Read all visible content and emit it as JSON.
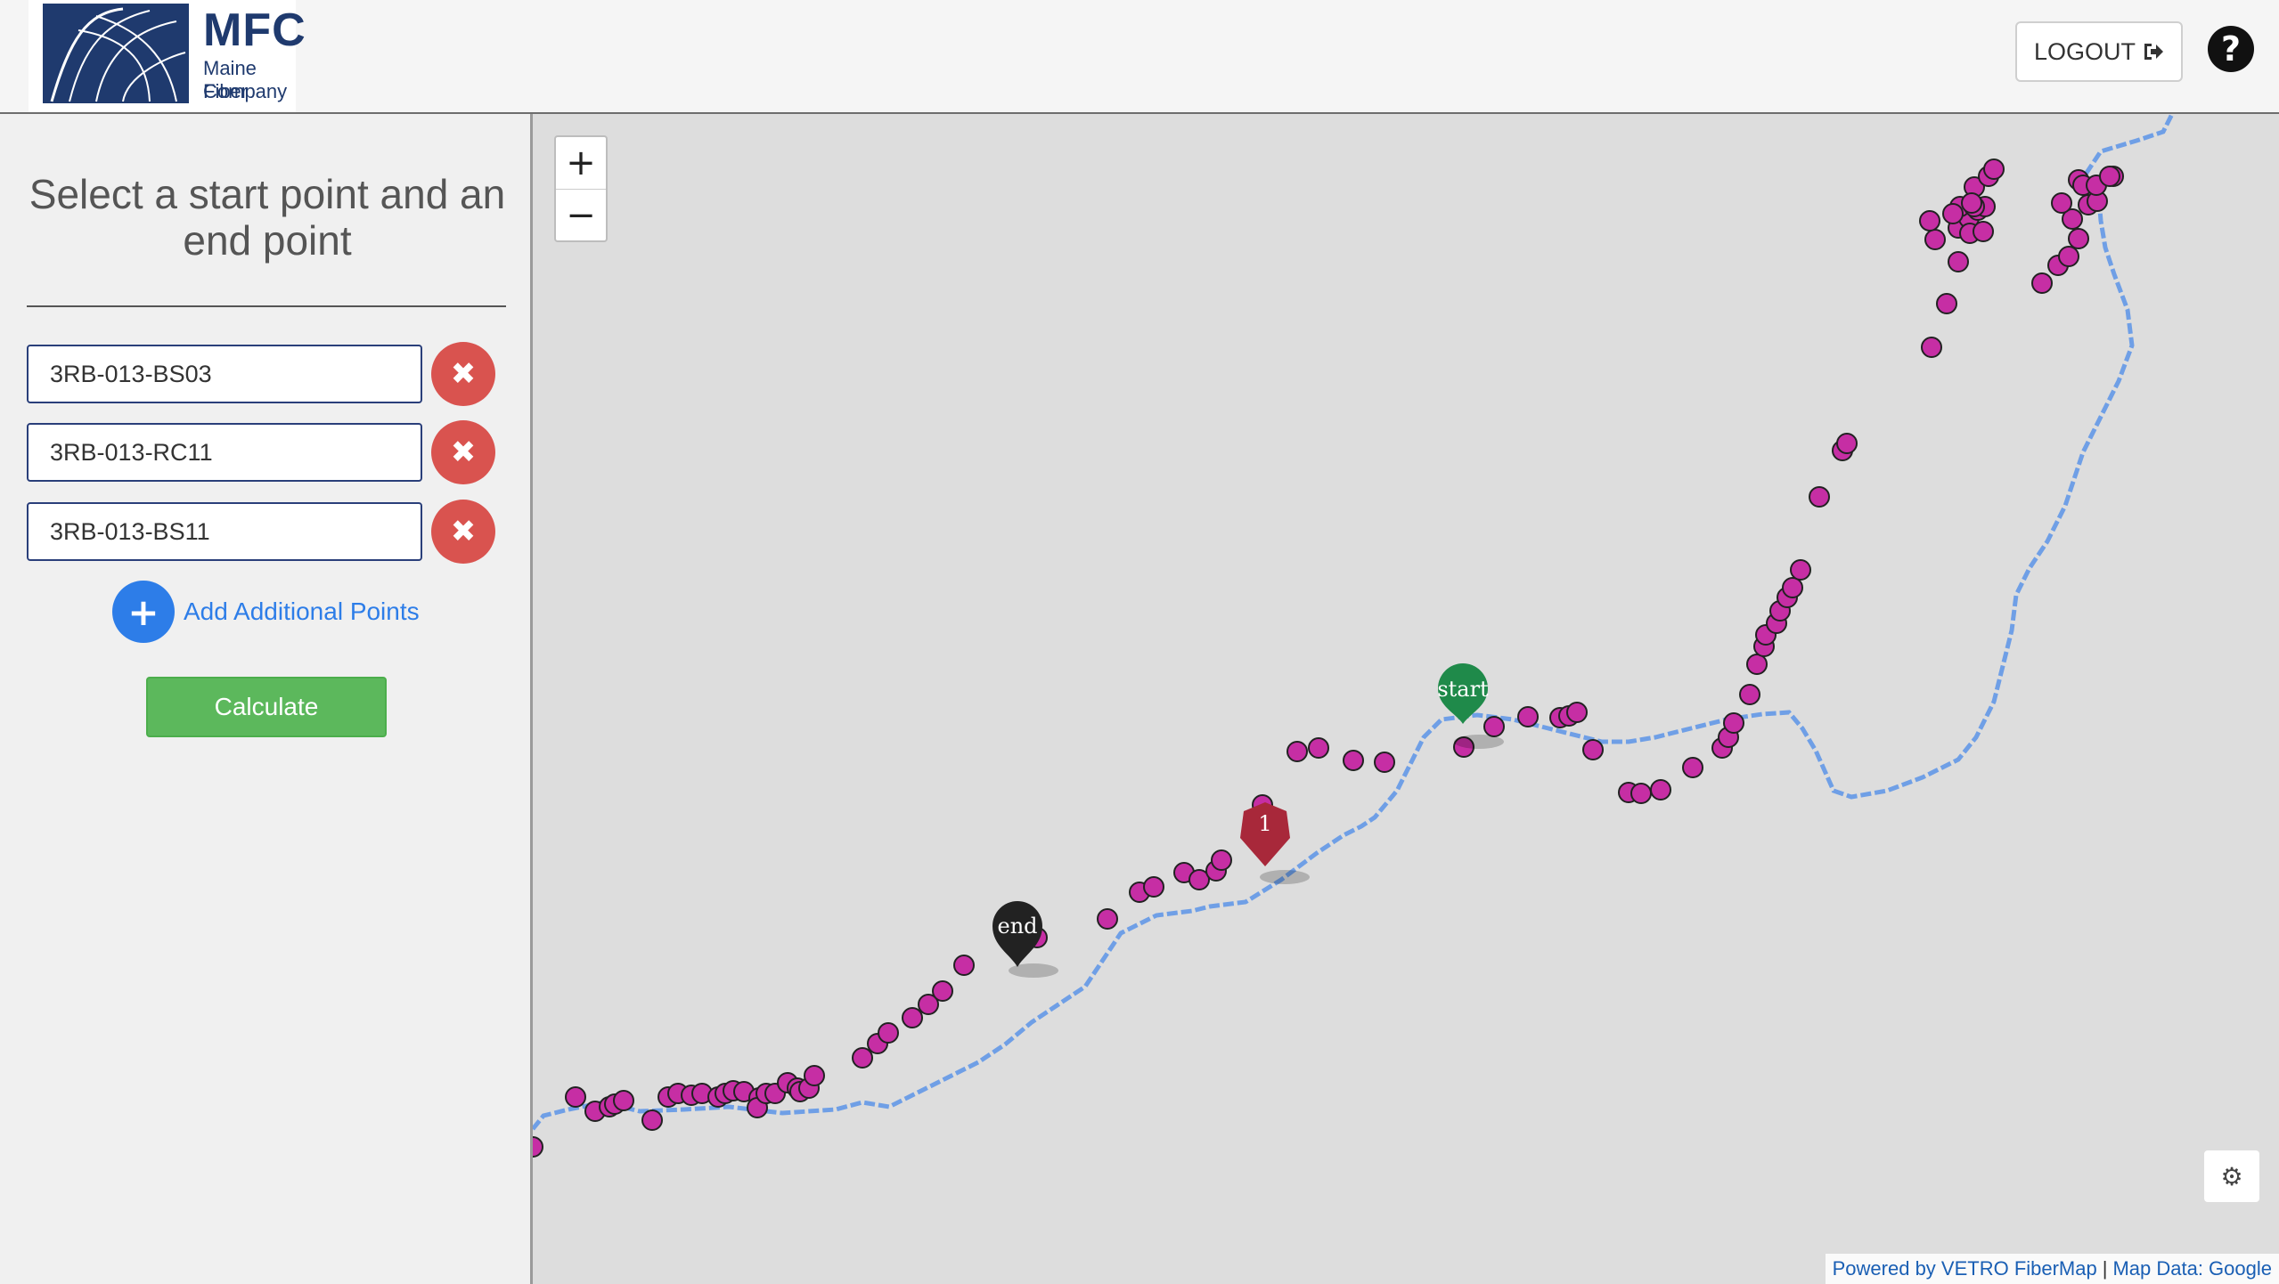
{
  "header": {
    "logo": {
      "big": "MFC",
      "line1": "Maine Fiber",
      "line2": "Company"
    },
    "logout_label": "LOGOUT",
    "logout_icon": "sign-out-icon",
    "help_icon": "question-circle-icon",
    "help_glyph": "?"
  },
  "sidebar": {
    "title": "Select a start point and an end point",
    "points": [
      {
        "value": "3RB-013-BS03"
      },
      {
        "value": "3RB-013-RC11"
      },
      {
        "value": "3RB-013-BS11"
      }
    ],
    "remove_glyph": "✖",
    "add_glyph": "+",
    "add_label": "Add Additional Points",
    "calculate_label": "Calculate"
  },
  "map": {
    "zoom_in": "+",
    "zoom_out": "−",
    "settings_icon": "gear-icon",
    "settings_glyph": "⚙",
    "markers": {
      "start": "start",
      "waypoint": "1",
      "end": "end"
    },
    "colors": {
      "route": "#6f9fe6",
      "node": "#c62ea4",
      "start": "#1f8a4a",
      "waypoint": "#a8283a",
      "end": "#222222"
    },
    "attribution": {
      "powered": "Powered by VETRO FiberMap",
      "separator": "|",
      "data": "Map Data: Google"
    }
  }
}
